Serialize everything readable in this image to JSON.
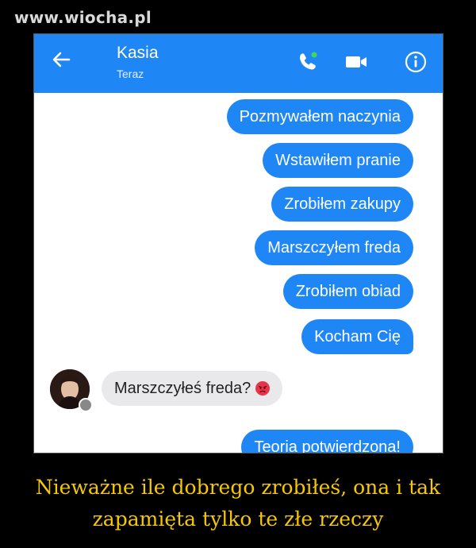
{
  "watermark": "www.wiocha.pl",
  "header": {
    "contact_name": "Kasia",
    "status": "Teraz",
    "icons": [
      "back-arrow-icon",
      "phone-call-icon",
      "video-camera-icon",
      "info-icon"
    ]
  },
  "messages": {
    "outgoing": [
      "Pozmywałem naczynia",
      "Wstawiłem pranie",
      "Zrobiłem zakupy",
      "Marszczyłem freda",
      "Zrobiłem obiad",
      "Kocham Cię"
    ],
    "incoming": "Marszczyłeś freda?",
    "incoming_emoji": "angry-face-icon",
    "reply": "Teoria potwierdzona!"
  },
  "caption": {
    "line1": "Nieważne ile dobrego zrobiłeś, ona i tak",
    "line2": "zapamięta tylko te złe rzeczy"
  },
  "colors": {
    "accent": "#1f86f5",
    "incoming_bubble": "#e9e9ec",
    "caption": "#f5c800",
    "background": "#000000"
  }
}
